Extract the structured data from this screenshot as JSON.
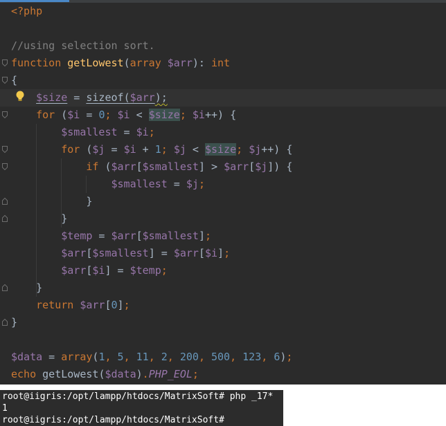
{
  "editor": {
    "lines": [
      [
        {
          "t": "<?php",
          "c": "tag"
        }
      ],
      [],
      [
        {
          "t": "//using selection sort.",
          "c": "cmt"
        }
      ],
      [
        {
          "t": "function ",
          "c": "kw"
        },
        {
          "t": "getLowest",
          "c": "fn"
        },
        {
          "t": "(",
          "c": "plain"
        },
        {
          "t": "array ",
          "c": "kw"
        },
        {
          "t": "$arr",
          "c": "var"
        },
        {
          "t": "): ",
          "c": "plain"
        },
        {
          "t": "int",
          "c": "kw"
        }
      ],
      [
        {
          "t": "{",
          "c": "plain"
        }
      ],
      [
        {
          "t": "    ",
          "c": "plain"
        },
        {
          "t": "$size",
          "c": "var ul"
        },
        {
          "t": " = ",
          "c": "plain"
        },
        {
          "t": "sizeof",
          "c": "plain ul"
        },
        {
          "t": "(",
          "c": "plain ul"
        },
        {
          "t": "$arr",
          "c": "var ul"
        },
        {
          "t": ");",
          "c": "plain squig"
        }
      ],
      [
        {
          "t": "    ",
          "c": "plain"
        },
        {
          "t": "for ",
          "c": "kw"
        },
        {
          "t": "(",
          "c": "plain"
        },
        {
          "t": "$i",
          "c": "var"
        },
        {
          "t": " = ",
          "c": "plain"
        },
        {
          "t": "0",
          "c": "num"
        },
        {
          "t": "; ",
          "c": "kw"
        },
        {
          "t": "$i",
          "c": "var"
        },
        {
          "t": " < ",
          "c": "plain"
        },
        {
          "t": "$size",
          "c": "var hl"
        },
        {
          "t": "; ",
          "c": "kw"
        },
        {
          "t": "$i",
          "c": "var"
        },
        {
          "t": "++) {",
          "c": "plain"
        }
      ],
      [
        {
          "t": "        ",
          "c": "plain"
        },
        {
          "t": "$smallest",
          "c": "var"
        },
        {
          "t": " = ",
          "c": "plain"
        },
        {
          "t": "$i",
          "c": "var"
        },
        {
          "t": ";",
          "c": "kw"
        }
      ],
      [
        {
          "t": "        ",
          "c": "plain"
        },
        {
          "t": "for ",
          "c": "kw"
        },
        {
          "t": "(",
          "c": "plain"
        },
        {
          "t": "$j",
          "c": "var"
        },
        {
          "t": " = ",
          "c": "plain"
        },
        {
          "t": "$i",
          "c": "var"
        },
        {
          "t": " + ",
          "c": "plain"
        },
        {
          "t": "1",
          "c": "num"
        },
        {
          "t": "; ",
          "c": "kw"
        },
        {
          "t": "$j",
          "c": "var"
        },
        {
          "t": " < ",
          "c": "plain"
        },
        {
          "t": "$size",
          "c": "var hl"
        },
        {
          "t": "; ",
          "c": "kw"
        },
        {
          "t": "$j",
          "c": "var"
        },
        {
          "t": "++) {",
          "c": "plain"
        }
      ],
      [
        {
          "t": "            ",
          "c": "plain"
        },
        {
          "t": "if ",
          "c": "kw"
        },
        {
          "t": "(",
          "c": "plain"
        },
        {
          "t": "$arr",
          "c": "var"
        },
        {
          "t": "[",
          "c": "plain"
        },
        {
          "t": "$smallest",
          "c": "var"
        },
        {
          "t": "] > ",
          "c": "plain"
        },
        {
          "t": "$arr",
          "c": "var"
        },
        {
          "t": "[",
          "c": "plain"
        },
        {
          "t": "$j",
          "c": "var"
        },
        {
          "t": "]) {",
          "c": "plain"
        }
      ],
      [
        {
          "t": "                ",
          "c": "plain"
        },
        {
          "t": "$smallest",
          "c": "var"
        },
        {
          "t": " = ",
          "c": "plain"
        },
        {
          "t": "$j",
          "c": "var"
        },
        {
          "t": ";",
          "c": "kw"
        }
      ],
      [
        {
          "t": "            }",
          "c": "plain"
        }
      ],
      [
        {
          "t": "        }",
          "c": "plain"
        }
      ],
      [
        {
          "t": "        ",
          "c": "plain"
        },
        {
          "t": "$temp",
          "c": "var"
        },
        {
          "t": " = ",
          "c": "plain"
        },
        {
          "t": "$arr",
          "c": "var"
        },
        {
          "t": "[",
          "c": "plain"
        },
        {
          "t": "$smallest",
          "c": "var"
        },
        {
          "t": "]",
          "c": "plain"
        },
        {
          "t": ";",
          "c": "kw"
        }
      ],
      [
        {
          "t": "        ",
          "c": "plain"
        },
        {
          "t": "$arr",
          "c": "var"
        },
        {
          "t": "[",
          "c": "plain"
        },
        {
          "t": "$smallest",
          "c": "var"
        },
        {
          "t": "] = ",
          "c": "plain"
        },
        {
          "t": "$arr",
          "c": "var"
        },
        {
          "t": "[",
          "c": "plain"
        },
        {
          "t": "$i",
          "c": "var"
        },
        {
          "t": "]",
          "c": "plain"
        },
        {
          "t": ";",
          "c": "kw"
        }
      ],
      [
        {
          "t": "        ",
          "c": "plain"
        },
        {
          "t": "$arr",
          "c": "var"
        },
        {
          "t": "[",
          "c": "plain"
        },
        {
          "t": "$i",
          "c": "var"
        },
        {
          "t": "] = ",
          "c": "plain"
        },
        {
          "t": "$temp",
          "c": "var"
        },
        {
          "t": ";",
          "c": "kw"
        }
      ],
      [
        {
          "t": "    }",
          "c": "plain"
        }
      ],
      [
        {
          "t": "    ",
          "c": "plain"
        },
        {
          "t": "return ",
          "c": "kw"
        },
        {
          "t": "$arr",
          "c": "var"
        },
        {
          "t": "[",
          "c": "plain"
        },
        {
          "t": "0",
          "c": "num"
        },
        {
          "t": "]",
          "c": "plain"
        },
        {
          "t": ";",
          "c": "kw"
        }
      ],
      [
        {
          "t": "}",
          "c": "plain"
        }
      ],
      [],
      [
        {
          "t": "$data",
          "c": "var"
        },
        {
          "t": " = ",
          "c": "plain"
        },
        {
          "t": "array",
          "c": "kw"
        },
        {
          "t": "(",
          "c": "plain"
        },
        {
          "t": "1",
          "c": "num"
        },
        {
          "t": ", ",
          "c": "kw"
        },
        {
          "t": "5",
          "c": "num"
        },
        {
          "t": ", ",
          "c": "kw"
        },
        {
          "t": "11",
          "c": "num"
        },
        {
          "t": ", ",
          "c": "kw"
        },
        {
          "t": "2",
          "c": "num"
        },
        {
          "t": ", ",
          "c": "kw"
        },
        {
          "t": "200",
          "c": "num"
        },
        {
          "t": ", ",
          "c": "kw"
        },
        {
          "t": "500",
          "c": "num"
        },
        {
          "t": ", ",
          "c": "kw"
        },
        {
          "t": "123",
          "c": "num"
        },
        {
          "t": ", ",
          "c": "kw"
        },
        {
          "t": "6",
          "c": "num"
        },
        {
          "t": ")",
          "c": "plain"
        },
        {
          "t": ";",
          "c": "kw"
        }
      ],
      [
        {
          "t": "echo ",
          "c": "kw"
        },
        {
          "t": "getLowest",
          "c": "plain"
        },
        {
          "t": "(",
          "c": "plain"
        },
        {
          "t": "$data",
          "c": "var"
        },
        {
          "t": ")",
          "c": "plain"
        },
        {
          "t": ".",
          "c": "kw"
        },
        {
          "t": "PHP_EOL",
          "c": "eol"
        },
        {
          "t": ";",
          "c": "kw"
        }
      ]
    ],
    "current_line": 5,
    "fold_markers": {
      "3": "open",
      "4": "open",
      "6": "open",
      "8": "open",
      "9": "open",
      "11": "close",
      "12": "close",
      "16": "close",
      "18": "close"
    }
  },
  "terminal": {
    "lines": [
      {
        "text": "root@iigris:/opt/lampp/htdocs/MatrixSoft# php _17*"
      },
      {
        "text": "1"
      },
      {
        "text": "root@iigris:/opt/lampp/htdocs/MatrixSoft# "
      }
    ]
  }
}
